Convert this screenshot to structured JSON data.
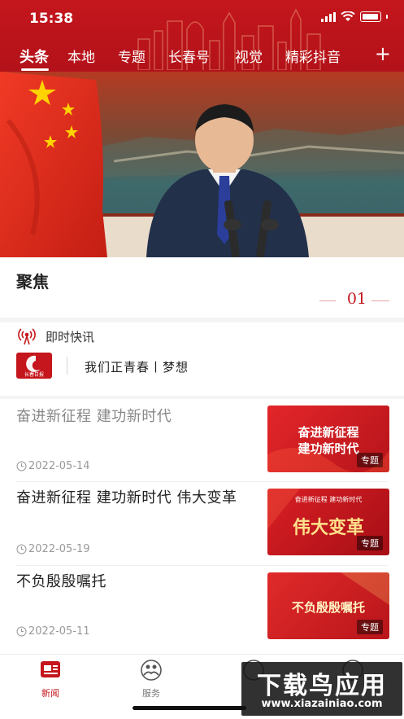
{
  "status_bar": {
    "time": "15:38"
  },
  "tabs": [
    "头条",
    "本地",
    "专题",
    "长春号",
    "视觉",
    "精彩抖音"
  ],
  "tabs_more": "+",
  "focus": {
    "title": "聚焦",
    "index": "01"
  },
  "flash": {
    "label": "即时快讯",
    "logo_text": "长春日报",
    "text": "我们正青春丨梦想"
  },
  "news": [
    {
      "title": "奋进新征程  建功新时代",
      "date": "2022-05-14",
      "read": true,
      "thumb_lines": [
        "奋进新征程",
        "建功新时代"
      ],
      "thumb_tag": "专题"
    },
    {
      "title": "奋进新征程  建功新时代  伟大变革",
      "date": "2022-05-19",
      "read": false,
      "thumb_lines": [
        "奋进新征程  建功新时代",
        "伟大变革"
      ],
      "thumb_tag": "专题"
    },
    {
      "title": "不负殷殷嘱托",
      "date": "2022-05-11",
      "read": false,
      "thumb_lines": [
        "不负殷殷嘱托"
      ],
      "thumb_tag": "专题"
    }
  ],
  "bottom_nav": [
    {
      "label": "新闻",
      "active": true
    },
    {
      "label": "服务",
      "active": false
    }
  ],
  "watermark": {
    "main": "下载鸟应用",
    "sub": "www.xiazainiao.com"
  },
  "colors": {
    "brand_red": "#c4161c",
    "flag_red": "#e8281e",
    "star_yellow": "#ffd200"
  }
}
